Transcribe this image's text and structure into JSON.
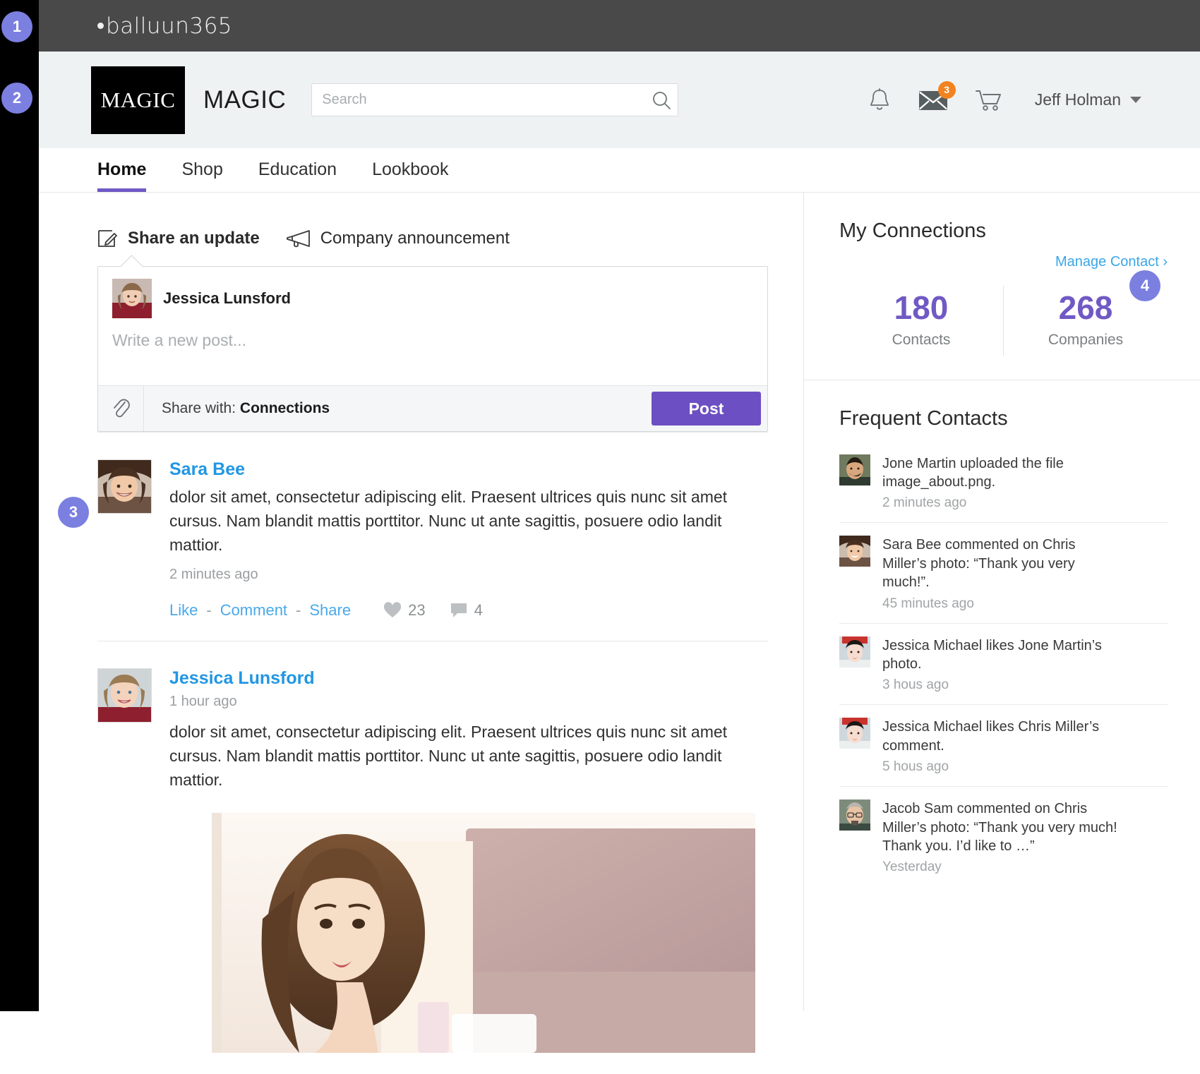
{
  "annotations": {
    "badges": [
      "1",
      "2",
      "3",
      "4"
    ],
    "badge_color": "#7b7fe0"
  },
  "topbar": {
    "brand": "balluun365"
  },
  "header": {
    "logo_mark_text": "MAGIC",
    "logo_word": "MAGIC",
    "search": {
      "placeholder": "Search",
      "value": "",
      "icon": "search-icon"
    },
    "icons": {
      "bell": "bell-icon",
      "mail": "envelope-icon",
      "mail_count": "3",
      "cart": "cart-icon"
    },
    "user": {
      "name": "Jeff Holman",
      "caret": "chevron-down-icon"
    },
    "badge_color": "#f28321"
  },
  "nav": {
    "tabs": [
      {
        "label": "Home",
        "active": true
      },
      {
        "label": "Shop",
        "active": false
      },
      {
        "label": "Education",
        "active": false
      },
      {
        "label": "Lookbook",
        "active": false
      }
    ],
    "active_underline_color": "#7059c4"
  },
  "composer": {
    "tabs": [
      {
        "label": "Share an update",
        "icon": "compose-pencil-icon",
        "active": true
      },
      {
        "label": "Company announcement",
        "icon": "megaphone-icon",
        "active": false
      }
    ],
    "author": "Jessica Lunsford",
    "placeholder": "Write a new post...",
    "value": "",
    "attach_icon": "paperclip-icon",
    "share_with_label": "Share with:",
    "share_with_value": "Connections",
    "post_label": "Post",
    "post_color": "#6c4fc2"
  },
  "feed": {
    "posts": [
      {
        "author": "Sara Bee",
        "text": "dolor sit amet, consectetur adipiscing elit. Praesent ultrices quis nunc sit amet cursus. Nam blandit mattis porttitor. Nunc ut ante sagittis, posuere odio landit mattior.",
        "time": "2 minutes ago",
        "time_position": "below",
        "actions": {
          "like": "Like",
          "comment": "Comment",
          "share": "Share",
          "separator": "-"
        },
        "likes": "23",
        "comments": "4",
        "has_image": false
      },
      {
        "author": "Jessica Lunsford",
        "text": "dolor sit amet, consectetur adipiscing elit. Praesent ultrices quis nunc sit amet cursus. Nam blandit mattis porttitor. Nunc ut ante sagittis, posuere odio landit mattior.",
        "time": "1 hour ago",
        "time_position": "above",
        "has_image": true
      }
    ]
  },
  "connections": {
    "title": "My Connections",
    "manage_link": "Manage Contact ›",
    "stats": [
      {
        "value": "180",
        "label": "Contacts"
      },
      {
        "value": "268",
        "label": "Companies"
      }
    ],
    "accent": "#7059c4"
  },
  "frequent_contacts": {
    "title": "Frequent Contacts",
    "items": [
      {
        "text": "Jone Martin uploaded the file image_about.png.",
        "time": "2 minutes ago"
      },
      {
        "text": "Sara Bee commented on Chris Miller’s photo: “Thank you very much!”.",
        "time": "45 minutes ago"
      },
      {
        "text": "Jessica Michael likes Jone Martin’s photo.",
        "time": "3 hous ago"
      },
      {
        "text": "Jessica Michael likes Chris Miller’s comment.",
        "time": "5 hous ago"
      },
      {
        "text": "Jacob Sam commented on Chris Miller’s photo: “Thank you very much! Thank you. I’d like to …”",
        "time": "Yesterday"
      }
    ]
  }
}
